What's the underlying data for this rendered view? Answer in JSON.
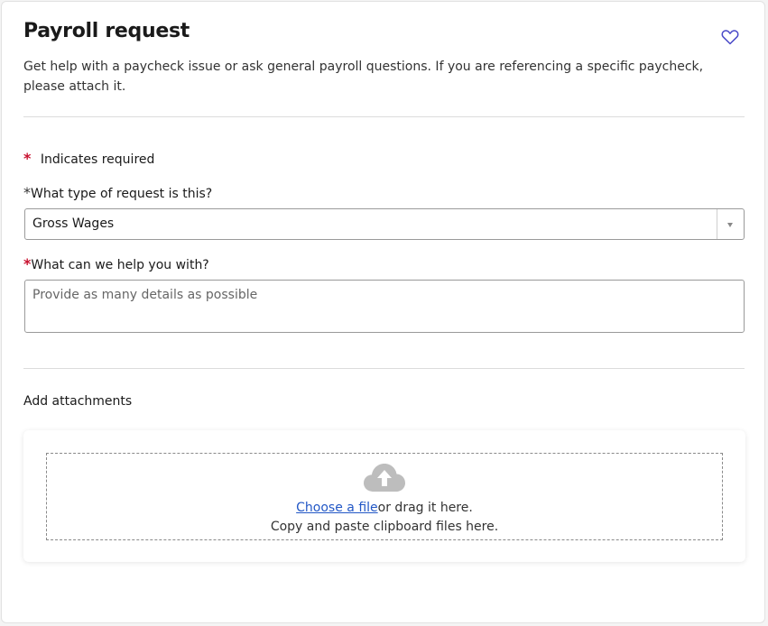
{
  "form": {
    "title": "Payroll request",
    "description": "Get help with a paycheck issue or ask general payroll questions. If you are referencing a specific paycheck, please attach it.",
    "required_marker": "*",
    "required_note": "Indicates required"
  },
  "fields": {
    "request_type": {
      "label": "What type of request is this?",
      "selected": "Gross Wages"
    },
    "help_details": {
      "label": "What can we help you with?",
      "placeholder": "Provide as many details as possible",
      "value": ""
    }
  },
  "attachments": {
    "title": "Add attachments",
    "choose_link": "Choose a file",
    "drag_text": "or drag it here.",
    "paste_text": "Copy and paste clipboard files here."
  },
  "colors": {
    "required_star": "#c8102e",
    "link": "#2257c6",
    "favorite_icon": "#4a4ac8",
    "upload_icon": "#bdbdbd"
  },
  "icons": {
    "favorite": "heart-outline-icon",
    "upload": "cloud-upload-icon",
    "dropdown": "caret-down-icon"
  }
}
